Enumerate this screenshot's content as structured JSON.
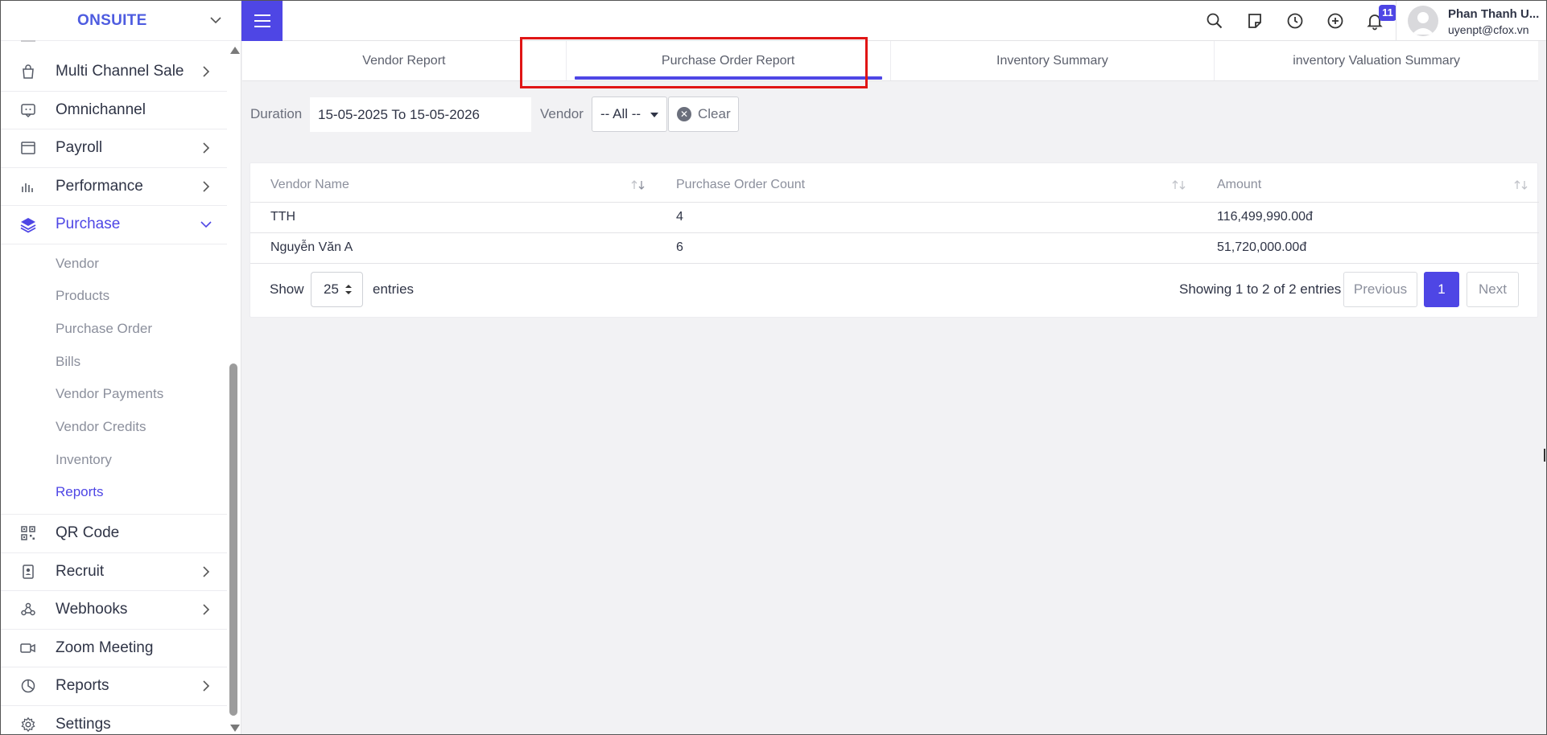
{
  "brand": {
    "name": "ONSUITE"
  },
  "sidebar": {
    "items": [
      {
        "label": "Multi Channel Sale",
        "icon": "shopping-bag-icon",
        "has_chevron": true
      },
      {
        "label": "Omnichannel",
        "icon": "chat-bubble-icon",
        "has_chevron": false
      },
      {
        "label": "Payroll",
        "icon": "calendar-window-icon",
        "has_chevron": true
      },
      {
        "label": "Performance",
        "icon": "bar-chart-icon",
        "has_chevron": true
      },
      {
        "label": "Purchase",
        "icon": "layers-icon",
        "has_chevron": true,
        "expanded": true
      }
    ],
    "purchase_sub": [
      {
        "label": "Vendor"
      },
      {
        "label": "Products"
      },
      {
        "label": "Purchase Order"
      },
      {
        "label": "Bills"
      },
      {
        "label": "Vendor Payments"
      },
      {
        "label": "Vendor Credits"
      },
      {
        "label": "Inventory"
      },
      {
        "label": "Reports",
        "active": true
      }
    ],
    "items_after": [
      {
        "label": "QR Code",
        "icon": "qr-code-icon",
        "has_chevron": false
      },
      {
        "label": "Recruit",
        "icon": "id-badge-icon",
        "has_chevron": true
      },
      {
        "label": "Webhooks",
        "icon": "webhook-icon",
        "has_chevron": true
      },
      {
        "label": "Zoom Meeting",
        "icon": "video-camera-icon",
        "has_chevron": false
      },
      {
        "label": "Reports",
        "icon": "pie-chart-icon",
        "has_chevron": true
      },
      {
        "label": "Settings",
        "icon": "gear-icon",
        "has_chevron": false
      }
    ]
  },
  "topbar": {
    "notification_count": "11",
    "user_name": "Phan Thanh U...",
    "user_email": "uyenpt@cfox.vn"
  },
  "tabs": [
    {
      "label": "Vendor Report",
      "active": false
    },
    {
      "label": "Purchase Order Report",
      "active": true
    },
    {
      "label": "Inventory Summary",
      "active": false
    },
    {
      "label": "inventory Valuation Summary",
      "active": false
    }
  ],
  "filters": {
    "duration_label": "Duration",
    "duration_value": "15-05-2025 To 15-05-2026",
    "vendor_label": "Vendor",
    "vendor_value": "-- All --",
    "clear_label": "Clear"
  },
  "table": {
    "columns": [
      "Vendor Name",
      "Purchase Order Count",
      "Amount"
    ],
    "rows": [
      [
        "TTH",
        "4",
        "116,499,990.00đ"
      ],
      [
        "Nguyễn Văn A",
        "6",
        "51,720,000.00đ"
      ]
    ]
  },
  "footer": {
    "show_label": "Show",
    "page_length": "25",
    "entries_label": "entries",
    "info": "Showing 1 to 2 of 2 entries",
    "prev_label": "Previous",
    "current_page": "1",
    "next_label": "Next"
  },
  "colors": {
    "accent": "#4e46e5",
    "highlight_border": "#e01515"
  }
}
